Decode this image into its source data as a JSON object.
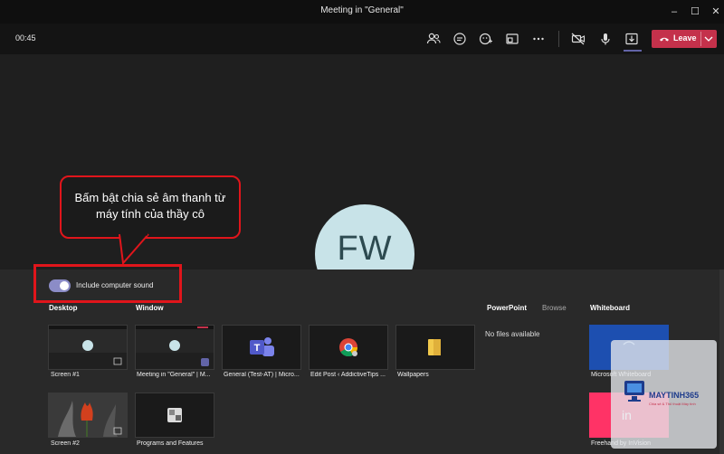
{
  "window": {
    "title": "Meeting in \"General\"",
    "controls": [
      "minimize",
      "maximize",
      "close"
    ]
  },
  "toolbar": {
    "timer": "00:45",
    "icons": [
      "participants-icon",
      "chat-icon",
      "reactions-icon",
      "rooms-icon",
      "more-icon",
      "camera-off-icon",
      "microphone-icon",
      "share-tray-icon"
    ],
    "leave_label": "Leave"
  },
  "colors": {
    "accent": "#6264a7",
    "leave": "#c4314b",
    "annotation": "#e0151b",
    "avatar_bg": "#c8e3e8"
  },
  "participant": {
    "initials": "FW"
  },
  "annotation": {
    "text": "Bấm bật chia sẻ âm thanh từ máy tính của thầy cô"
  },
  "share_tray": {
    "toggle_label": "Include computer sound",
    "toggle_on": true,
    "sections": {
      "desktop": "Desktop",
      "window": "Window",
      "powerpoint": "PowerPoint",
      "browse": "Browse",
      "whiteboard": "Whiteboard"
    },
    "screens": [
      {
        "label": "Screen #1"
      },
      {
        "label": "Screen #2"
      }
    ],
    "windows": [
      {
        "label": "Meeting in \"General\" | M...",
        "icon": "teams-window-icon"
      },
      {
        "label": "General (Test-AT) | Micro...",
        "icon": "teams-app-icon"
      },
      {
        "label": "Edit Post ‹ AddictiveTips ...",
        "icon": "chrome-icon"
      },
      {
        "label": "Wallpapers",
        "icon": "folder-icon"
      },
      {
        "label": "Programs and Features",
        "icon": "programs-features-icon"
      }
    ],
    "powerpoint_empty": "No files available",
    "whiteboards": [
      {
        "label": "Microsoft Whiteboard"
      },
      {
        "label": "Freehand by InVision"
      }
    ]
  },
  "watermark": {
    "brand": "MAYTINH365",
    "tagline": "Chia sẻ & Thủ thuật Máy tính"
  }
}
